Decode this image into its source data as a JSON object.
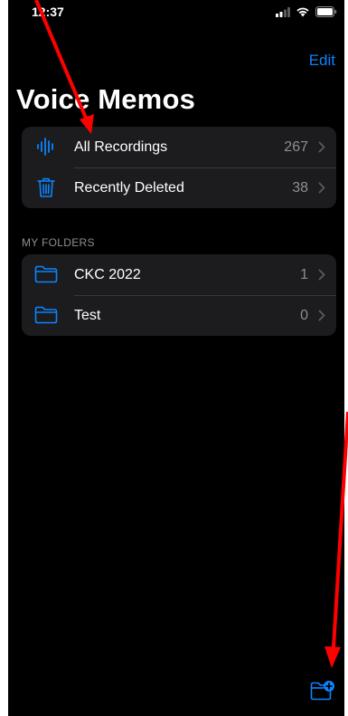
{
  "status_bar": {
    "time": "12:37"
  },
  "header": {
    "edit_label": "Edit",
    "title": "Voice Memos"
  },
  "library": [
    {
      "label": "All Recordings",
      "count": "267",
      "icon": "waveform-icon"
    },
    {
      "label": "Recently Deleted",
      "count": "38",
      "icon": "trash-icon"
    }
  ],
  "folders_section": {
    "header": "MY FOLDERS",
    "items": [
      {
        "label": "CKC 2022",
        "count": "1",
        "icon": "folder-icon"
      },
      {
        "label": "Test",
        "count": "0",
        "icon": "folder-icon"
      }
    ]
  },
  "toolbar": {
    "new_folder_icon": "new-folder-icon"
  },
  "colors": {
    "accent": "#0a84ff",
    "background": "#000000",
    "cell": "#1c1c1e",
    "secondary_text": "#8e8e93",
    "annotation": "#ff0000"
  }
}
